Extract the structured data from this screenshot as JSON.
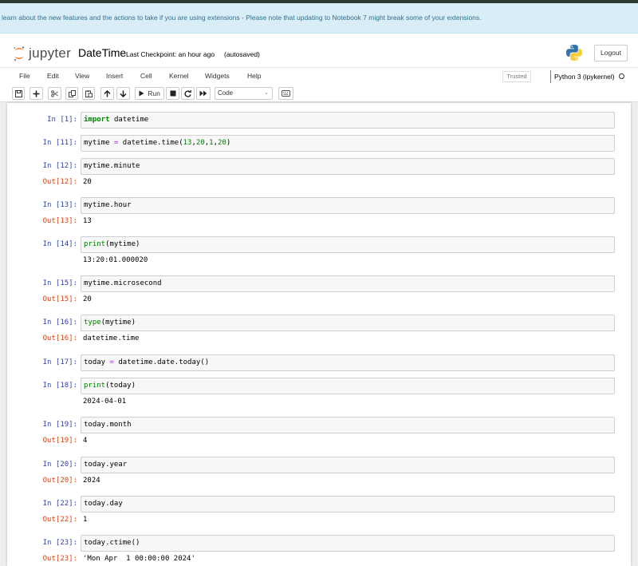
{
  "banner": {
    "text": "learn about the new features and the actions to take if you are using extensions - Please note that updating to Notebook 7 might break some of your extensions."
  },
  "header": {
    "logo_text": "jupyter",
    "notebook_name": "DateTime",
    "checkpoint": "Last Checkpoint: an hour ago",
    "autosave": "(autosaved)",
    "logout_label": "Logout"
  },
  "menubar": {
    "items": [
      "File",
      "Edit",
      "View",
      "Insert",
      "Cell",
      "Kernel",
      "Widgets",
      "Help"
    ],
    "trusted_label": "Trusted",
    "kernel_name": "Python 3 (ipykernel)"
  },
  "toolbar": {
    "run_label": "Run",
    "cell_type": "Code"
  },
  "cells": [
    {
      "in": "In [1]:",
      "code": [
        [
          "kw",
          "import"
        ],
        [
          "",
          "datetime"
        ]
      ]
    },
    {
      "in": "In [11]:",
      "code": [
        [
          "",
          "mytime "
        ],
        [
          "op",
          "="
        ],
        [
          "",
          "datetime.time("
        ],
        [
          "num",
          "13"
        ],
        [
          "",
          ","
        ],
        [
          "num",
          "20"
        ],
        [
          "",
          ","
        ],
        [
          "num",
          "1"
        ],
        [
          "",
          ","
        ],
        [
          "num",
          "20"
        ],
        [
          "",
          ")"
        ]
      ]
    },
    {
      "in": "In [12]:",
      "code": [
        [
          "",
          "mytime.minute"
        ]
      ],
      "out_prompt": "Out[12]:",
      "output": "20"
    },
    {
      "in": "In [13]:",
      "code": [
        [
          "",
          "mytime.hour"
        ]
      ],
      "out_prompt": "Out[13]:",
      "output": "13"
    },
    {
      "in": "In [14]:",
      "code": [
        [
          "fn",
          "print"
        ],
        [
          "",
          "(mytime)"
        ]
      ],
      "out_prompt": "",
      "output": "13:20:01.000020"
    },
    {
      "in": "In [15]:",
      "code": [
        [
          "",
          "mytime.microsecond"
        ]
      ],
      "out_prompt": "Out[15]:",
      "output": "20"
    },
    {
      "in": "In [16]:",
      "code": [
        [
          "fn",
          "type"
        ],
        [
          "",
          "(mytime)"
        ]
      ],
      "out_prompt": "Out[16]:",
      "output": "datetime.time"
    },
    {
      "in": "In [17]:",
      "code": [
        [
          "",
          "today "
        ],
        [
          "op",
          "="
        ],
        [
          "",
          "datetime.date.today()"
        ]
      ]
    },
    {
      "in": "In [18]:",
      "code": [
        [
          "fn",
          "print"
        ],
        [
          "",
          "(today)"
        ]
      ],
      "out_prompt": "",
      "output": "2024-04-01"
    },
    {
      "in": "In [19]:",
      "code": [
        [
          "",
          "today.month"
        ]
      ],
      "out_prompt": "Out[19]:",
      "output": "4"
    },
    {
      "in": "In [20]:",
      "code": [
        [
          "",
          "today.year"
        ]
      ],
      "out_prompt": "Out[20]:",
      "output": "2024"
    },
    {
      "in": "In [22]:",
      "code": [
        [
          "",
          "today.day"
        ]
      ],
      "out_prompt": "Out[22]:",
      "output": "1"
    },
    {
      "in": "In [23]:",
      "code": [
        [
          "",
          "today.ctime()"
        ]
      ],
      "out_prompt": "Out[23]:",
      "output": "'Mon Apr  1 00:00:00 2024'"
    }
  ]
}
